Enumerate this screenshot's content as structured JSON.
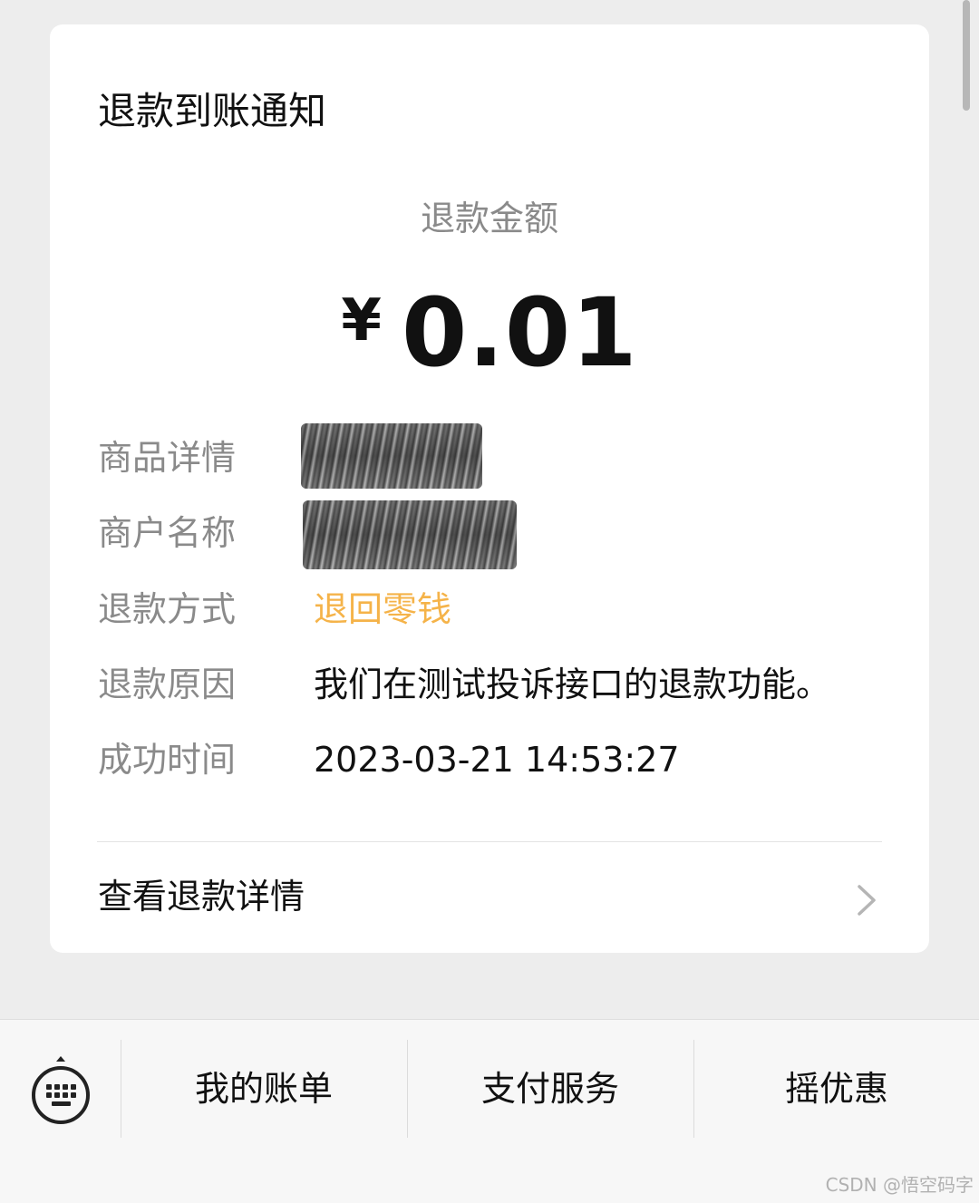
{
  "card": {
    "title": "退款到账通知",
    "amount_label": "退款金额",
    "amount_currency": "¥",
    "amount_value": "0.01",
    "rows": [
      {
        "label": "商品详情",
        "value": ""
      },
      {
        "label": "商户名称",
        "value": ""
      },
      {
        "label": "退款方式",
        "value": "退回零钱"
      },
      {
        "label": "退款原因",
        "value": "我们在测试投诉接口的退款功能。"
      },
      {
        "label": "成功时间",
        "value": "2023-03-21 14:53:27"
      }
    ],
    "detail_link_label": "查看退款详情"
  },
  "bottom_menu": {
    "items": [
      {
        "label": "我的账单"
      },
      {
        "label": "支付服务"
      },
      {
        "label": "摇优惠"
      }
    ]
  },
  "watermark": "CSDN @悟空码字",
  "colors": {
    "accent": "#f5b349",
    "label_gray": "#8a8a8a",
    "page_bg": "#ededed"
  },
  "icons": {
    "keyboard": "keyboard-icon",
    "chevron": "chevron-right-icon"
  }
}
